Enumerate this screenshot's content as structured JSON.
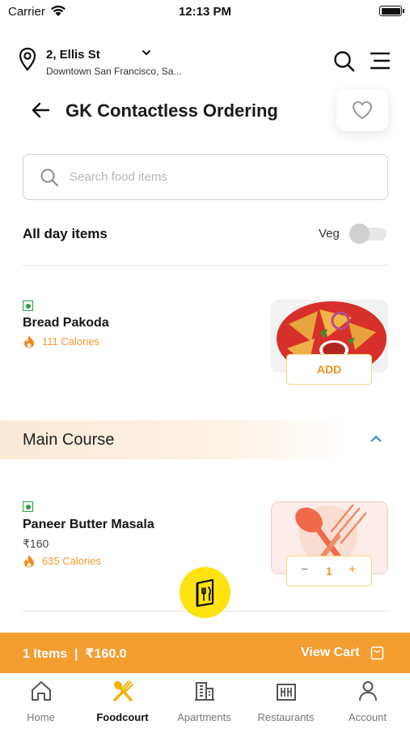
{
  "status_bar": {
    "carrier": "Carrier",
    "time": "12:13 PM"
  },
  "location": {
    "title": "2, Ellis St",
    "subtitle": "Downtown San Francisco, Sa..."
  },
  "page": {
    "title": "GK Contactless Ordering"
  },
  "search": {
    "placeholder": "Search food items"
  },
  "filter": {
    "section_label": "All day items",
    "veg_label": "Veg",
    "veg_only": false
  },
  "items": [
    {
      "name": "Bread Pakoda",
      "price": "",
      "calories": "111 Calories",
      "action": "ADD"
    },
    {
      "name": "Paneer Butter Masala",
      "price": "₹160",
      "calories": "635 Calories",
      "quantity": "1",
      "minus": "−",
      "plus": "+"
    }
  ],
  "section": {
    "title": "Main Course"
  },
  "cart": {
    "summary": "1 Items  |  ₹160.0",
    "view_label": "View Cart"
  },
  "tabs": [
    {
      "label": "Home",
      "icon": "home-icon"
    },
    {
      "label": "Foodcourt",
      "icon": "spoon-fork-icon",
      "active": true
    },
    {
      "label": "Apartments",
      "icon": "building-icon"
    },
    {
      "label": "Restaurants",
      "icon": "restaurant-icon"
    },
    {
      "label": "Account",
      "icon": "person-icon"
    }
  ],
  "colors": {
    "accent": "#f49d31",
    "veg": "#2e9e3f",
    "fab": "#ffe310",
    "calorie": "#f19a2e"
  }
}
